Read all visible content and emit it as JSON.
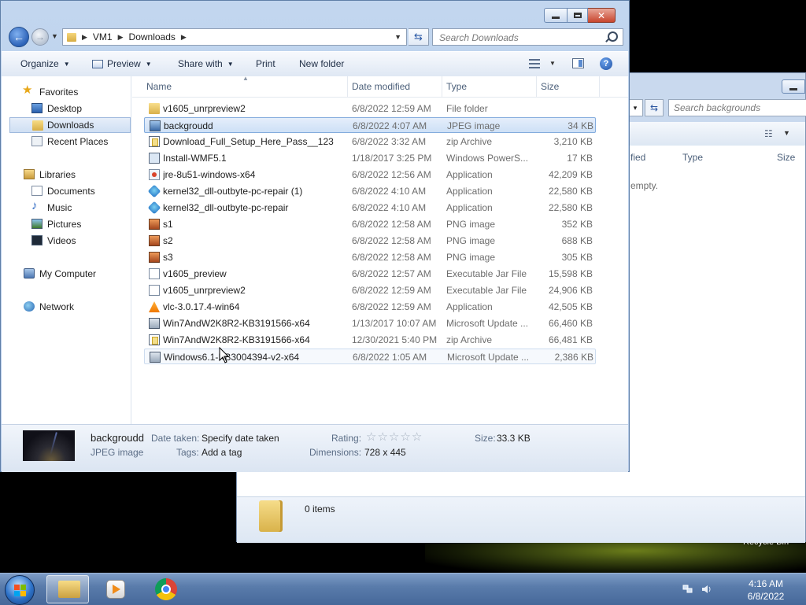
{
  "background_window": {
    "search_placeholder": "Search backgrounds",
    "col_modified_partial": "fied",
    "col_type": "Type",
    "col_size": "Size",
    "empty_partial": "empty.",
    "status_items": "0 items"
  },
  "desktop": {
    "recycle_bin_partial": "Recycle Bin"
  },
  "window": {
    "address": [
      "VM1",
      "Downloads"
    ],
    "search_placeholder": "Search Downloads",
    "toolbar": {
      "organize": "Organize",
      "preview": "Preview",
      "share_with": "Share with",
      "print": "Print",
      "new_folder": "New folder"
    },
    "nav": {
      "favorites": "Favorites",
      "desktop": "Desktop",
      "downloads": "Downloads",
      "recent_places": "Recent Places",
      "libraries": "Libraries",
      "documents": "Documents",
      "music": "Music",
      "pictures": "Pictures",
      "videos": "Videos",
      "my_computer": "My Computer",
      "network": "Network"
    },
    "columns": {
      "name": "Name",
      "date_modified": "Date modified",
      "type": "Type",
      "size": "Size"
    },
    "files": [
      {
        "name": "v1605_unrpreview2",
        "date": "6/8/2022 12:59 AM",
        "type": "File folder",
        "size": "",
        "icon": "folder-icon"
      },
      {
        "name": "backgroudd",
        "date": "6/8/2022 4:07 AM",
        "type": "JPEG image",
        "size": "34 KB",
        "icon": "jpeg-file-icon"
      },
      {
        "name": "Download_Full_Setup_Here_Pass__123",
        "date": "6/8/2022 3:32 AM",
        "type": "zip Archive",
        "size": "3,210 KB",
        "icon": "zip-archive-icon"
      },
      {
        "name": "Install-WMF5.1",
        "date": "1/18/2017 3:25 PM",
        "type": "Windows PowerS...",
        "size": "17 KB",
        "icon": "powershell-script-icon"
      },
      {
        "name": "jre-8u51-windows-x64",
        "date": "6/8/2022 12:56 AM",
        "type": "Application",
        "size": "42,209 KB",
        "icon": "java-installer-icon"
      },
      {
        "name": "kernel32_dll-outbyte-pc-repair (1)",
        "date": "6/8/2022 4:10 AM",
        "type": "Application",
        "size": "22,580 KB",
        "icon": "repair-app-icon"
      },
      {
        "name": "kernel32_dll-outbyte-pc-repair",
        "date": "6/8/2022 4:10 AM",
        "type": "Application",
        "size": "22,580 KB",
        "icon": "repair-app-icon"
      },
      {
        "name": "s1",
        "date": "6/8/2022 12:58 AM",
        "type": "PNG image",
        "size": "352 KB",
        "icon": "png-file-icon"
      },
      {
        "name": "s2",
        "date": "6/8/2022 12:58 AM",
        "type": "PNG image",
        "size": "688 KB",
        "icon": "png-file-icon"
      },
      {
        "name": "s3",
        "date": "6/8/2022 12:58 AM",
        "type": "PNG image",
        "size": "305 KB",
        "icon": "png-file-icon"
      },
      {
        "name": "v1605_preview",
        "date": "6/8/2022 12:57 AM",
        "type": "Executable Jar File",
        "size": "15,598 KB",
        "icon": "jar-file-icon"
      },
      {
        "name": "v1605_unrpreview2",
        "date": "6/8/2022 12:59 AM",
        "type": "Executable Jar File",
        "size": "24,906 KB",
        "icon": "jar-file-icon"
      },
      {
        "name": "vlc-3.0.17.4-win64",
        "date": "6/8/2022 12:59 AM",
        "type": "Application",
        "size": "42,505 KB",
        "icon": "vlc-icon"
      },
      {
        "name": "Win7AndW2K8R2-KB3191566-x64",
        "date": "1/13/2017 10:07 AM",
        "type": "Microsoft Update ...",
        "size": "66,460 KB",
        "icon": "update-package-icon"
      },
      {
        "name": "Win7AndW2K8R2-KB3191566-x64",
        "date": "12/30/2021 5:40 PM",
        "type": "zip Archive",
        "size": "66,481 KB",
        "icon": "zip-archive-icon"
      },
      {
        "name": "Windows6.1-KB3004394-v2-x64",
        "date": "6/8/2022 1:05 AM",
        "type": "Microsoft Update ...",
        "size": "2,386 KB",
        "icon": "update-package-icon"
      }
    ],
    "details": {
      "file_name": "backgroudd",
      "file_type": "JPEG image",
      "date_taken_label": "Date taken:",
      "date_taken_value": "Specify date taken",
      "tags_label": "Tags:",
      "tags_value": "Add a tag",
      "rating_label": "Rating:",
      "rating_stars": 0,
      "dimensions_label": "Dimensions:",
      "dimensions_value": "728 x 445",
      "size_label": "Size:",
      "size_value": "33.3 KB"
    }
  },
  "taskbar": {
    "time": "4:16 AM",
    "date": "6/8/2022"
  },
  "colors": {
    "selection_border": "#84acdd",
    "window_frame": "#b3c9e8",
    "taskbar": "#5a7cab"
  }
}
